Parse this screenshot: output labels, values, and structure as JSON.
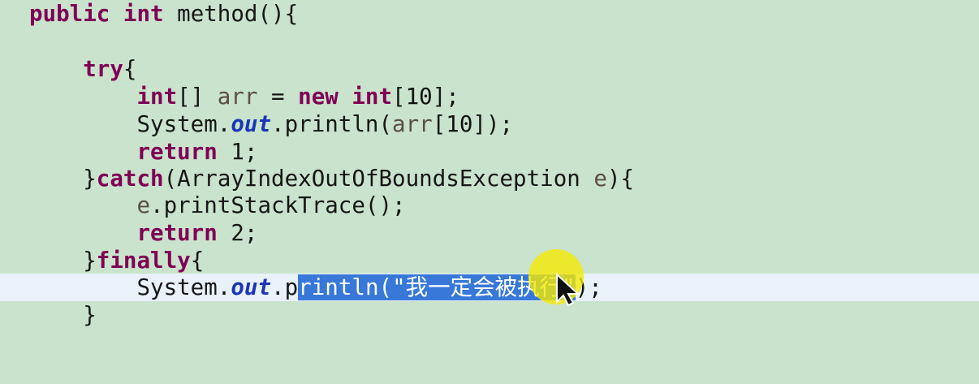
{
  "editor": {
    "background": "#c9e3cc",
    "current_line_background": "#e9f1fb",
    "selection_background": "#3778d9",
    "keyword_color": "#800055",
    "field_color": "#1b36b7",
    "cursor_highlight_color": "#f6ea00",
    "lines": [
      {
        "tokens": [
          {
            "text": "public",
            "kind": "keyword"
          },
          {
            "text": " ",
            "kind": "plain"
          },
          {
            "text": "int",
            "kind": "keyword"
          },
          {
            "text": " method(){",
            "kind": "plain"
          }
        ]
      },
      {
        "tokens": []
      },
      {
        "tokens": [
          {
            "text": "    ",
            "kind": "plain"
          },
          {
            "text": "try",
            "kind": "keyword"
          },
          {
            "text": "{",
            "kind": "plain"
          }
        ]
      },
      {
        "tokens": [
          {
            "text": "        ",
            "kind": "plain"
          },
          {
            "text": "int",
            "kind": "keyword"
          },
          {
            "text": "[] ",
            "kind": "plain"
          },
          {
            "text": "arr",
            "kind": "variable"
          },
          {
            "text": " = ",
            "kind": "plain"
          },
          {
            "text": "new",
            "kind": "keyword"
          },
          {
            "text": " ",
            "kind": "plain"
          },
          {
            "text": "int",
            "kind": "keyword"
          },
          {
            "text": "[",
            "kind": "plain"
          },
          {
            "text": "10",
            "kind": "number"
          },
          {
            "text": "];",
            "kind": "plain"
          }
        ]
      },
      {
        "tokens": [
          {
            "text": "        System.",
            "kind": "plain"
          },
          {
            "text": "out",
            "kind": "field"
          },
          {
            "text": ".println(",
            "kind": "plain"
          },
          {
            "text": "arr",
            "kind": "variable"
          },
          {
            "text": "[",
            "kind": "plain"
          },
          {
            "text": "10",
            "kind": "number"
          },
          {
            "text": "]);",
            "kind": "plain"
          }
        ]
      },
      {
        "tokens": [
          {
            "text": "        ",
            "kind": "plain"
          },
          {
            "text": "return",
            "kind": "keyword"
          },
          {
            "text": " 1;",
            "kind": "plain"
          }
        ]
      },
      {
        "tokens": [
          {
            "text": "    }",
            "kind": "plain"
          },
          {
            "text": "catch",
            "kind": "keyword"
          },
          {
            "text": "(ArrayIndexOutOfBoundsException ",
            "kind": "plain"
          },
          {
            "text": "e",
            "kind": "variable"
          },
          {
            "text": "){",
            "kind": "plain"
          }
        ]
      },
      {
        "tokens": [
          {
            "text": "        ",
            "kind": "plain"
          },
          {
            "text": "e",
            "kind": "variable"
          },
          {
            "text": ".printStackTrace();",
            "kind": "plain"
          }
        ]
      },
      {
        "tokens": [
          {
            "text": "        ",
            "kind": "plain"
          },
          {
            "text": "return",
            "kind": "keyword"
          },
          {
            "text": " 2;",
            "kind": "plain"
          }
        ]
      },
      {
        "tokens": [
          {
            "text": "    }",
            "kind": "plain"
          },
          {
            "text": "finally",
            "kind": "keyword"
          },
          {
            "text": "{",
            "kind": "plain"
          }
        ]
      },
      {
        "current": true,
        "tokens": [
          {
            "text": "        System.",
            "kind": "plain"
          },
          {
            "text": "out",
            "kind": "field"
          },
          {
            "text": ".p",
            "kind": "plain"
          },
          {
            "text": "rintln(",
            "kind": "selected"
          },
          {
            "text": "\"我一定会被执行\"",
            "kind": "selected-string"
          },
          {
            "text": ");",
            "kind": "plain"
          }
        ]
      },
      {
        "tokens": [
          {
            "text": "    }",
            "kind": "plain"
          }
        ]
      }
    ]
  }
}
